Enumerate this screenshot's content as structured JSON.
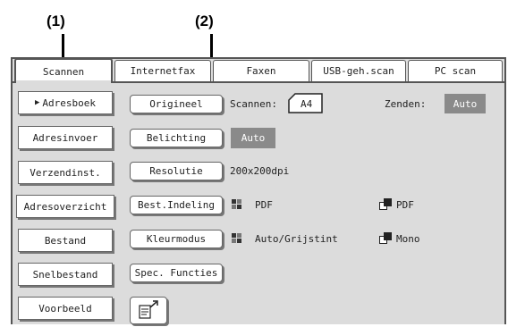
{
  "callouts": {
    "one": "(1)",
    "two": "(2)"
  },
  "tabs": [
    {
      "label": "Scannen",
      "active": true
    },
    {
      "label": "Internetfax"
    },
    {
      "label": "Faxen"
    },
    {
      "label": "USB-geh.scan"
    },
    {
      "label": "PC scan"
    }
  ],
  "sidebar": [
    {
      "label": "Adresboek",
      "arrow": "▶"
    },
    {
      "label": "Adresinvoer"
    },
    {
      "label": "Verzendinst."
    },
    {
      "label": "Adresoverzicht"
    },
    {
      "label": "Bestand"
    },
    {
      "label": "Snelbestand"
    },
    {
      "label": "Voorbeeld"
    }
  ],
  "settings": {
    "origineel": {
      "label": "Origineel",
      "scan_label": "Scannen:",
      "scan_value": "A4",
      "send_label": "Zenden:",
      "send_value": "Auto"
    },
    "belichting": {
      "label": "Belichting",
      "value": "Auto"
    },
    "resolutie": {
      "label": "Resolutie",
      "value": "200x200dpi"
    },
    "bestindeling": {
      "label": "Best.Indeling",
      "color_value": "PDF",
      "mono_value": "PDF"
    },
    "kleurmodus": {
      "label": "Kleurmodus",
      "color_value": "Auto/Grijstint",
      "mono_value": "Mono"
    },
    "spec": {
      "label": "Spec. Functies"
    }
  },
  "icons": {
    "grid": "color-grid-icon",
    "mono": "mono-square-icon",
    "page": "page-corner-icon",
    "preview": "preview-rotate-icon"
  }
}
